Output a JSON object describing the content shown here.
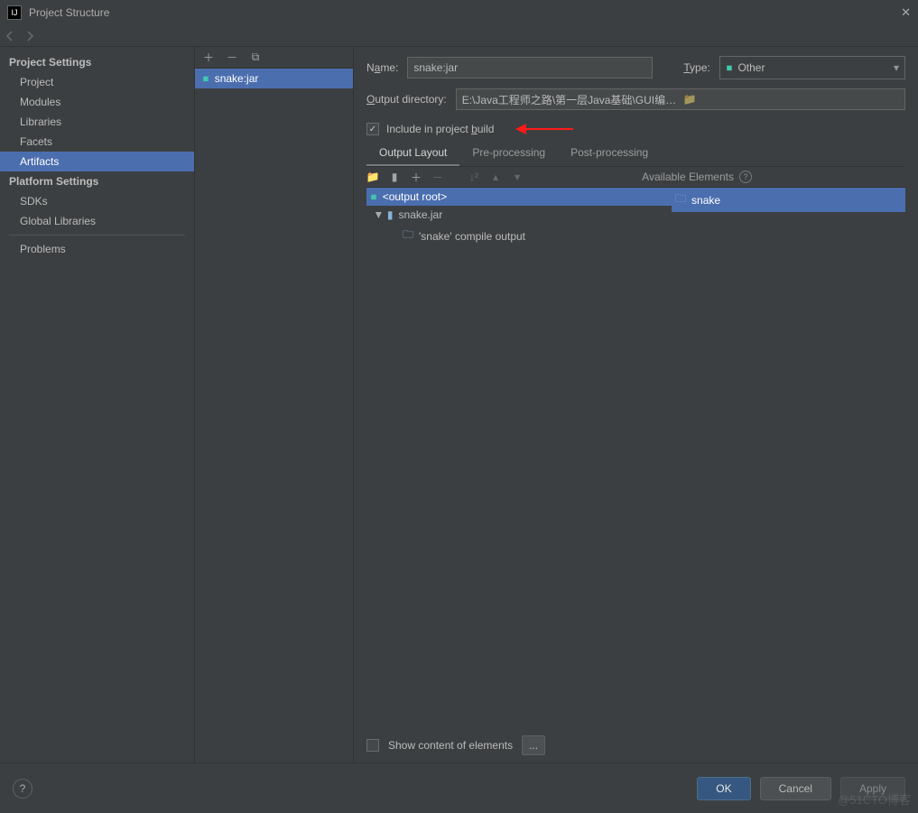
{
  "titlebar": {
    "title": "Project Structure"
  },
  "sidebar": {
    "headers": {
      "project": "Project Settings",
      "platform": "Platform Settings"
    },
    "project_items": [
      "Project",
      "Modules",
      "Libraries",
      "Facets",
      "Artifacts"
    ],
    "platform_items": [
      "SDKs",
      "Global Libraries"
    ],
    "extra": [
      "Problems"
    ],
    "selected": "Artifacts"
  },
  "midbar": {
    "item": "snake:jar"
  },
  "form": {
    "name_label_pre": "N",
    "name_label_ul": "a",
    "name_label_post": "me:",
    "name_value": "snake:jar",
    "type_label_pre": "",
    "type_label_ul": "T",
    "type_label_post": "ype:",
    "type_value": "Other",
    "outdir_label_pre": "",
    "outdir_label_ul": "O",
    "outdir_label_post": "utput directory:",
    "outdir_value": "E:\\Java工程师之路\\第一层Java基础\\GUI编程\\snake\\out\\artifacts\\snake_jar",
    "include_pre": "Include in project ",
    "include_ul": "b",
    "include_post": "uild",
    "include_checked": true
  },
  "tabs": {
    "items": [
      "Output Layout",
      "Pre-processing",
      "Post-processing"
    ],
    "active": "Output Layout"
  },
  "layout": {
    "avail_label": "Available Elements",
    "left_root": "<output root>",
    "left": [
      {
        "depth": 0,
        "icon": "archive",
        "text": "snake.jar"
      },
      {
        "depth": 1,
        "icon": "folder",
        "text": "'snake' compile output"
      }
    ],
    "right_root": "snake"
  },
  "footer": {
    "show_content": "Show content of elements"
  },
  "buttons": {
    "ok": "OK",
    "cancel": "Cancel",
    "apply": "Apply"
  },
  "watermark": "@51CTO博客"
}
